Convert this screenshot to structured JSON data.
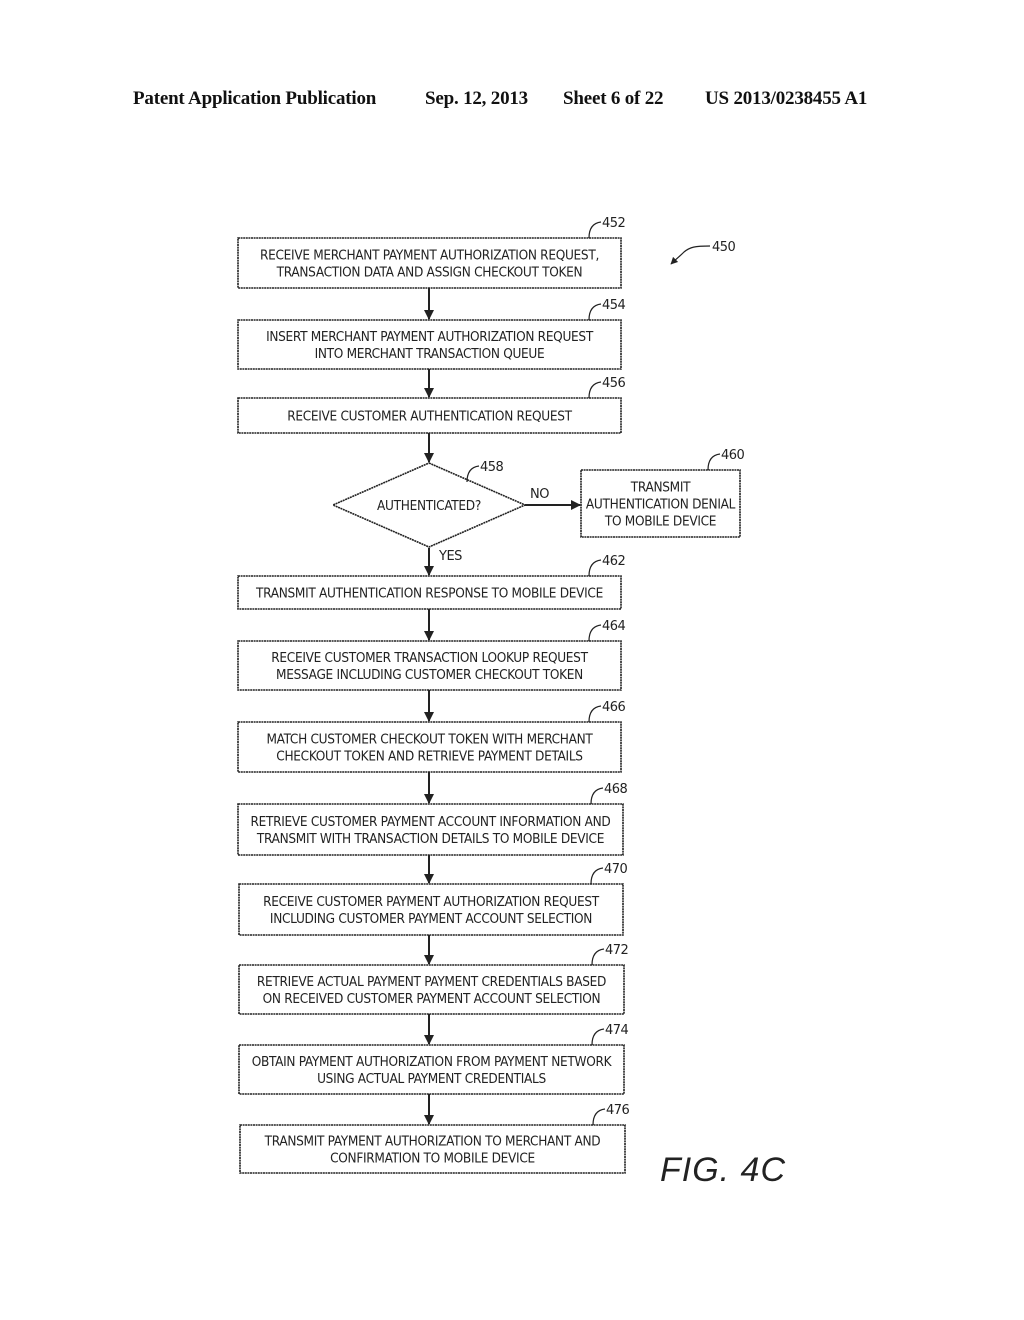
{
  "header": {
    "publication": "Patent Application Publication",
    "date": "Sep. 12, 2013",
    "sheet": "Sheet 6 of 22",
    "number": "US 2013/0238455 A1"
  },
  "figure": {
    "label": "FIG. 4C",
    "ref": "450"
  },
  "steps": [
    {
      "ref": "452",
      "lines": [
        "RECEIVE MERCHANT PAYMENT AUTHORIZATION REQUEST,",
        "TRANSACTION DATA AND ASSIGN CHECKOUT TOKEN"
      ]
    },
    {
      "ref": "454",
      "lines": [
        "INSERT MERCHANT PAYMENT AUTHORIZATION REQUEST",
        "INTO MERCHANT TRANSACTION QUEUE"
      ]
    },
    {
      "ref": "456",
      "lines": [
        "RECEIVE CUSTOMER AUTHENTICATION REQUEST"
      ]
    },
    {
      "ref": "458",
      "lines": [
        "AUTHENTICATED?"
      ]
    },
    {
      "ref": "460",
      "lines": [
        "TRANSMIT",
        "AUTHENTICATION DENIAL",
        "TO MOBILE DEVICE"
      ]
    },
    {
      "ref": "462",
      "lines": [
        "TRANSMIT AUTHENTICATION RESPONSE TO MOBILE DEVICE"
      ]
    },
    {
      "ref": "464",
      "lines": [
        "RECEIVE CUSTOMER TRANSACTION LOOKUP REQUEST",
        "MESSAGE INCLUDING CUSTOMER CHECKOUT TOKEN"
      ]
    },
    {
      "ref": "466",
      "lines": [
        "MATCH CUSTOMER CHECKOUT TOKEN WITH MERCHANT",
        "CHECKOUT TOKEN AND RETRIEVE PAYMENT DETAILS"
      ]
    },
    {
      "ref": "468",
      "lines": [
        "RETRIEVE CUSTOMER PAYMENT ACCOUNT INFORMATION AND",
        "TRANSMIT WITH TRANSACTION DETAILS TO MOBILE DEVICE"
      ]
    },
    {
      "ref": "470",
      "lines": [
        "RECEIVE CUSTOMER PAYMENT AUTHORIZATION REQUEST",
        "INCLUDING CUSTOMER PAYMENT ACCOUNT SELECTION"
      ]
    },
    {
      "ref": "472",
      "lines": [
        "RETRIEVE ACTUAL PAYMENT PAYMENT CREDENTIALS BASED",
        "ON RECEIVED CUSTOMER PAYMENT ACCOUNT SELECTION"
      ]
    },
    {
      "ref": "474",
      "lines": [
        "OBTAIN PAYMENT AUTHORIZATION FROM PAYMENT NETWORK",
        "USING ACTUAL PAYMENT CREDENTIALS"
      ]
    },
    {
      "ref": "476",
      "lines": [
        "TRANSMIT PAYMENT AUTHORIZATION TO MERCHANT AND",
        "CONFIRMATION TO MOBILE DEVICE"
      ]
    }
  ],
  "branches": {
    "no": "NO",
    "yes": "YES"
  }
}
